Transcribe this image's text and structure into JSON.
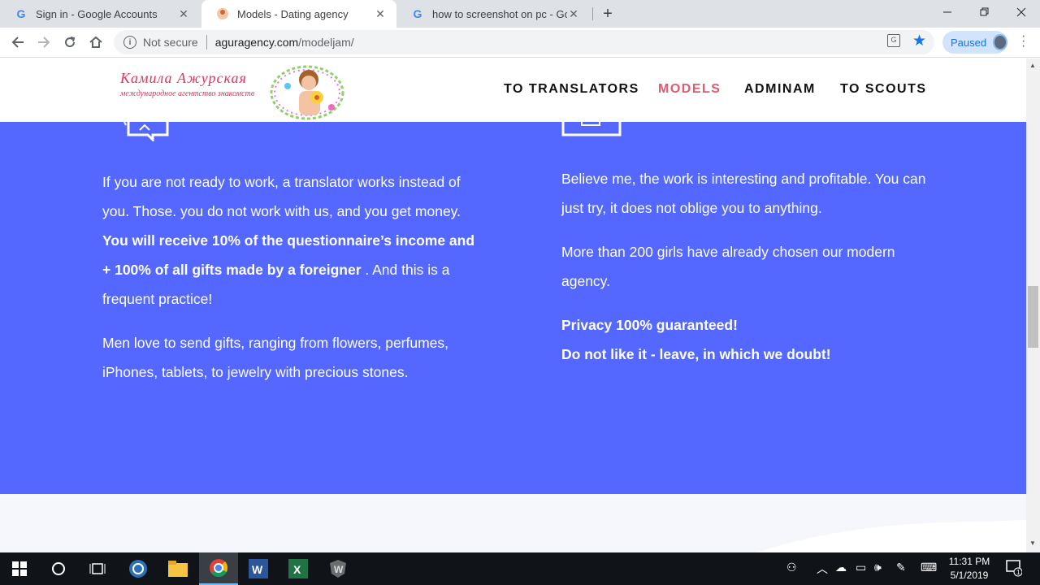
{
  "browser": {
    "tabs": [
      {
        "title": "Sign in - Google Accounts",
        "favicon": "google-g-icon",
        "close": "✕"
      },
      {
        "title": "Models - Dating agency",
        "favicon": "site-icon",
        "close": "✕"
      },
      {
        "title": "how to screenshot on pc - Googl",
        "favicon": "google-g-icon",
        "close": "✕"
      }
    ],
    "new_tab": "+",
    "omnibox": {
      "security": "Not secure",
      "host": "aguragency.com",
      "path": "/modeljam/"
    },
    "profile": {
      "label": "Paused"
    },
    "accent": "#1a73e8"
  },
  "site": {
    "logo": {
      "name": "Камила  Ажурская",
      "tagline": "международное агентство знакомств"
    },
    "nav": [
      {
        "label": "TO TRANSLATORS"
      },
      {
        "label": "MODELS"
      },
      {
        "label": "ADMINAM"
      },
      {
        "label": "TO SCOUTS"
      }
    ],
    "colors": {
      "section_bg": "#5468ff",
      "nav_active": "#e05a6d",
      "logo": "#e0355a"
    },
    "left_column": {
      "p1_a": "If you are not ready to work, a translator works instead of you.   Those. you do not work with us, and you get money. ",
      "p1_bold": "You will receive 10% of the questionnaire’s income and + 100% of all gifts made by a foreigner",
      "p1_c": " . And this is a frequent practice!",
      "p2": "Men love to send gifts, ranging from flowers, perfumes, iPhones, tablets, to jewelry with precious stones."
    },
    "right_column": {
      "p1": "Believe me, the work is interesting and profitable. You can just try, it does not oblige you to anything.",
      "p2": "More than 200 girls have already chosen our modern agency.",
      "p3_bold_1": "Privacy 100% guaranteed!",
      "p3_bold_2": "Do not like it - leave, in which we doubt!"
    }
  },
  "taskbar": {
    "time": "11:31 PM",
    "date": "5/1/2019",
    "notification_count": "1"
  }
}
